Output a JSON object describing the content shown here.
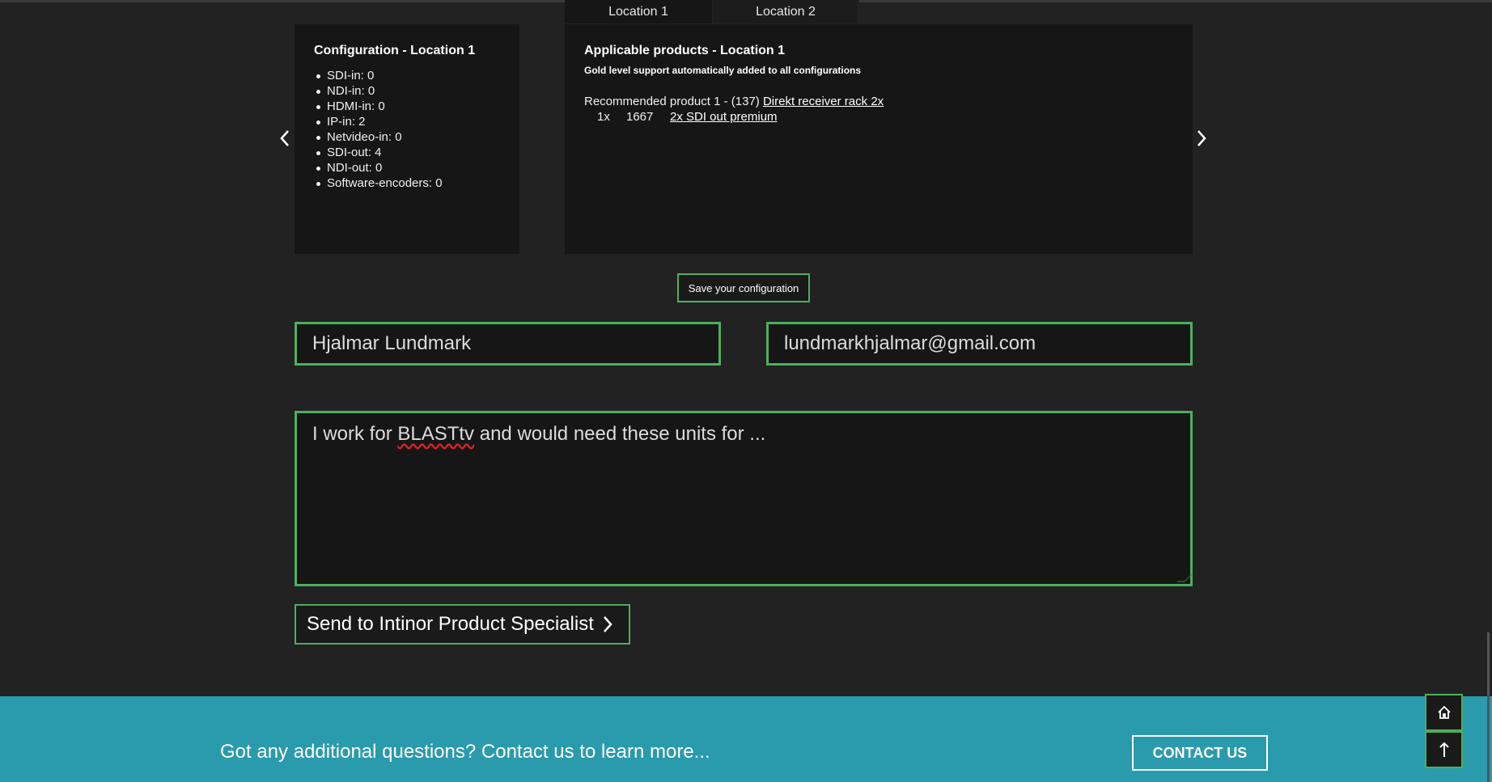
{
  "tabs": [
    {
      "label": "Location 1"
    },
    {
      "label": "Location 2"
    }
  ],
  "config_panel": {
    "title": "Configuration - Location 1",
    "items": [
      "SDI-in: 0",
      "NDI-in: 0",
      "HDMI-in: 0",
      "IP-in: 2",
      "Netvideo-in: 0",
      "SDI-out: 4",
      "NDI-out: 0",
      "Software-encoders: 0"
    ]
  },
  "products_panel": {
    "title": "Applicable products - Location 1",
    "gold_note": "Gold level support automatically added to all configurations",
    "recommended_prefix": "Recommended product 1 - (137)",
    "recommended_link": "Direkt receiver rack 2x",
    "sub_qty": "1x",
    "sub_code": "1667",
    "sub_link": "2x SDI out premium"
  },
  "save_button": {
    "label": "Save your configuration"
  },
  "form": {
    "name_value": "Hjalmar Lundmark",
    "email_value": "lundmarkhjalmar@gmail.com",
    "message_before": "I work for ",
    "message_misspelled": "BLASTtv",
    "message_after": " and would need these units for ..."
  },
  "send_button": {
    "label": "Send to Intinor Product Specialist"
  },
  "footer": {
    "text": "Got any additional questions? Contact us to learn more...",
    "contact_label": "CONTACT US"
  },
  "icons": {
    "prev": "chevron-left-icon",
    "next": "chevron-right-icon",
    "send": "chevron-right-icon",
    "home": "home-icon",
    "top": "arrow-up-icon"
  },
  "colors": {
    "accent_green": "#4cb05c",
    "footer_teal": "#2a9aad",
    "panel_bg": "#161616",
    "page_bg": "#222222"
  }
}
